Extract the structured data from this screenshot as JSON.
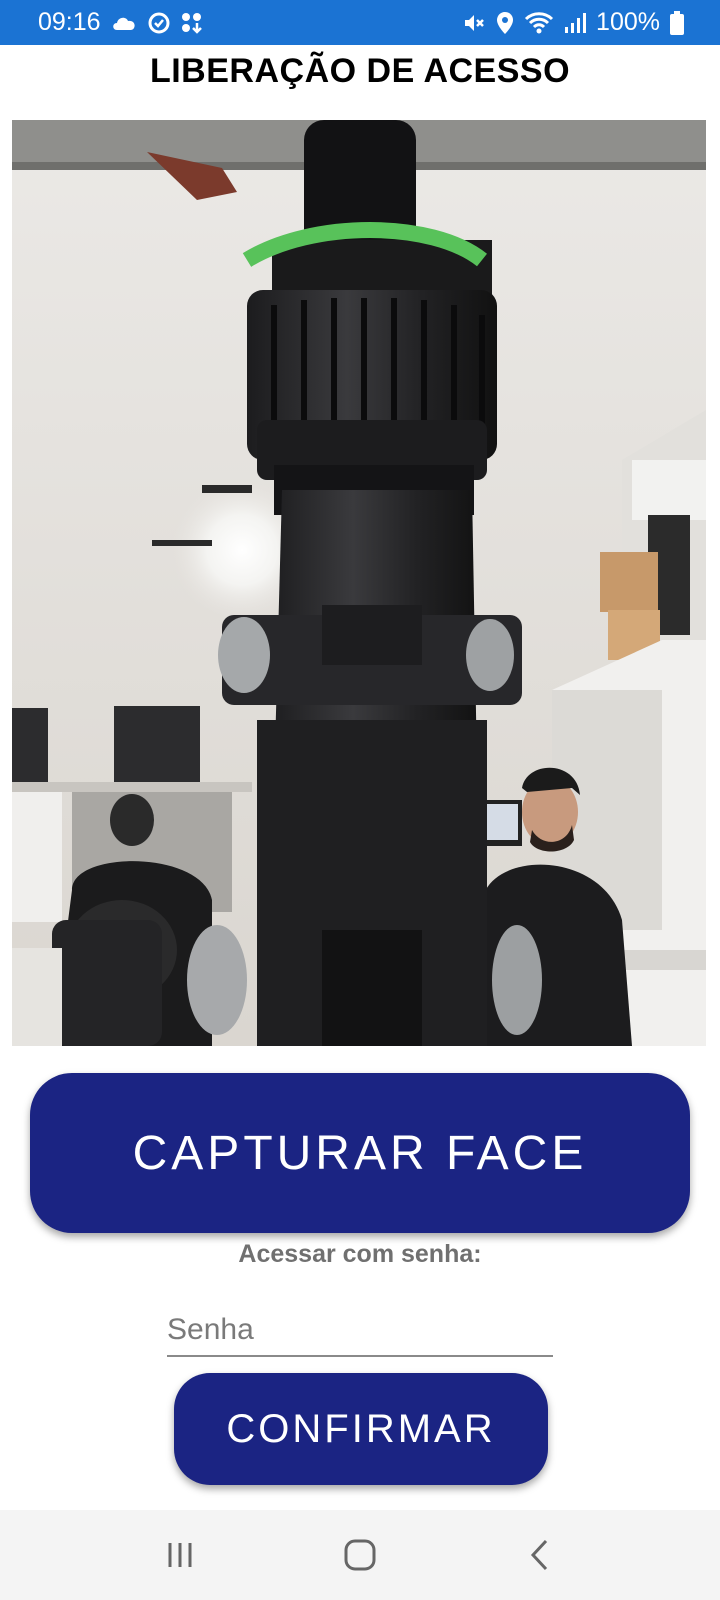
{
  "status_bar": {
    "time": "09:16",
    "battery": "100%",
    "left_icons": [
      "cloud-icon",
      "sync-icon",
      "apps-icon"
    ],
    "right_icons": [
      "mute-icon",
      "location-icon",
      "wifi-icon",
      "signal-icon",
      "battery-icon"
    ]
  },
  "header": {
    "title": "LIBERAÇÃO DE ACESSO"
  },
  "camera": {
    "description_icon": "camera-preview"
  },
  "actions": {
    "capture_label": "CAPTURAR FACE",
    "password_prompt": "Acessar com senha:",
    "password_placeholder": "Senha",
    "password_value": "",
    "confirm_label": "CONFIRMAR"
  },
  "nav": {
    "items": [
      "recents-icon",
      "home-icon",
      "back-icon"
    ]
  },
  "colors": {
    "status_bar": "#1b73d3",
    "button": "#1b2483",
    "nav_bar": "#f4f4f4"
  }
}
